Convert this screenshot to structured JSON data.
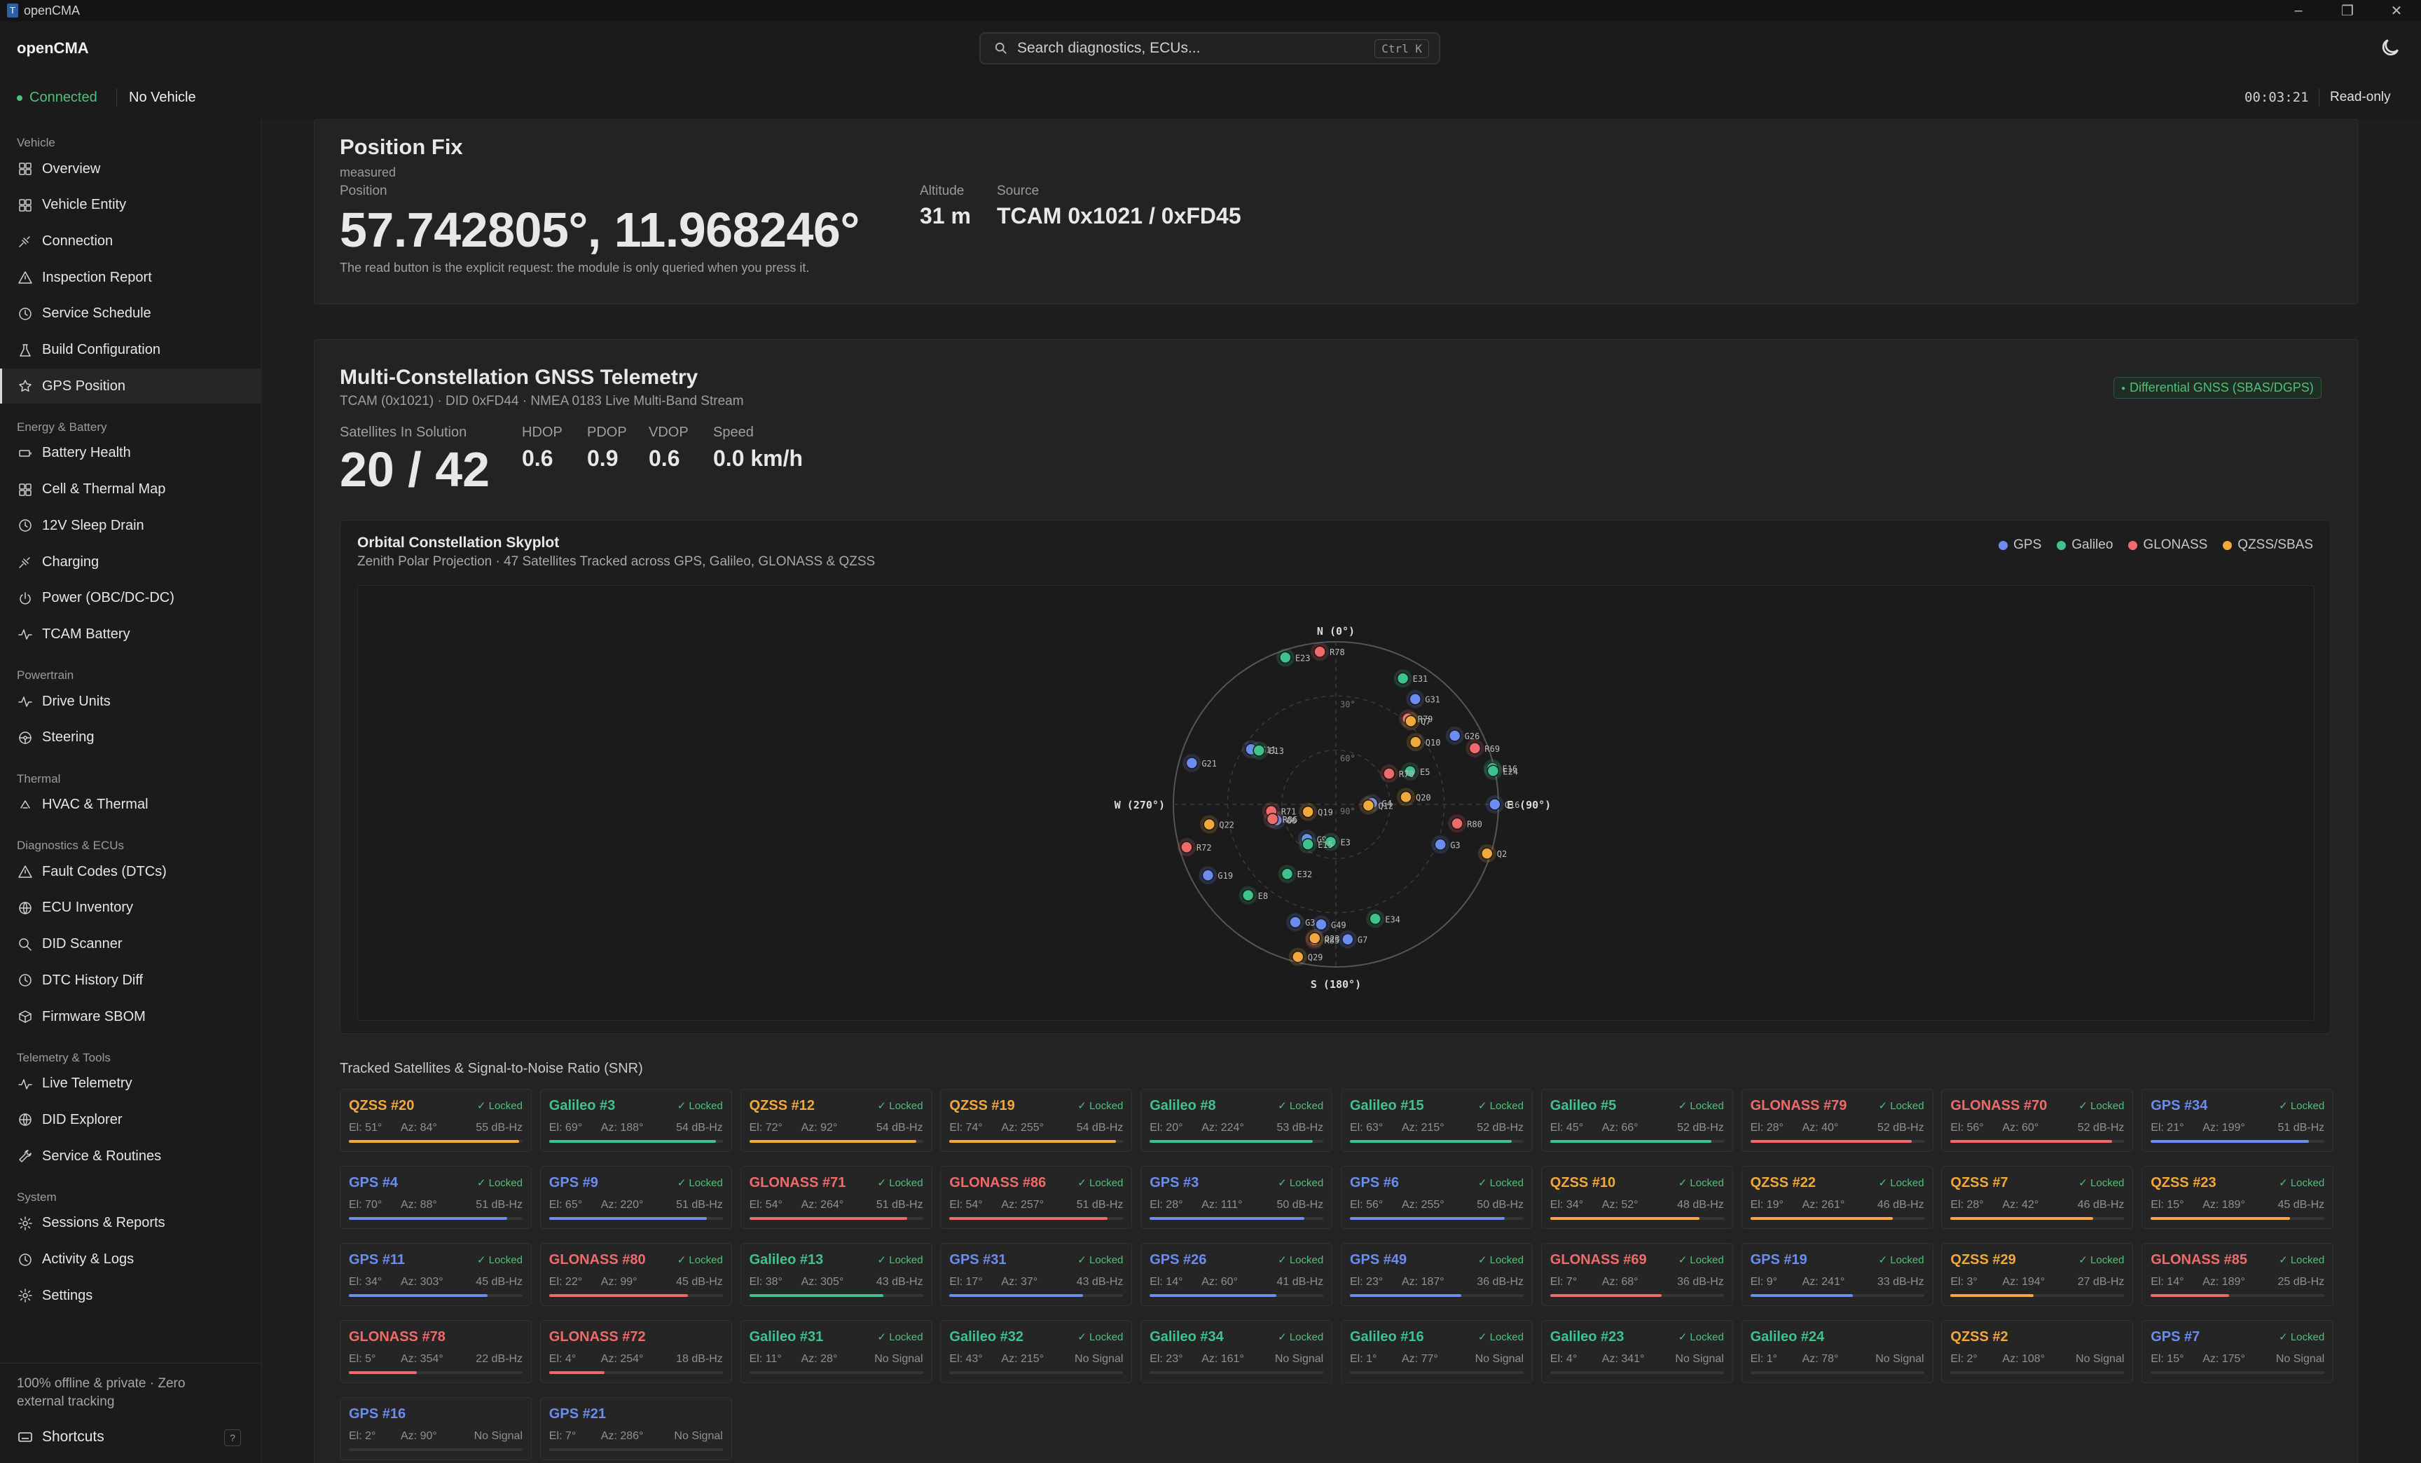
{
  "window": {
    "title": "openCMA"
  },
  "header": {
    "brand": "openCMA",
    "search_placeholder": "Search diagnostics, ECUs...",
    "search_shortcut": "Ctrl K"
  },
  "status": {
    "connection": "Connected",
    "vehicle": "No Vehicle",
    "clock": "00:03:21",
    "mode": "Read-only"
  },
  "colors": {
    "GPS": "#6b8cf0",
    "Galileo": "#3fc28b",
    "GLONASS": "#ef6b6b",
    "QZSS": "#f2a83b",
    "accent_green": "#4ec07a"
  },
  "sidebar": {
    "groups": [
      {
        "label": "Vehicle",
        "items": [
          {
            "label": "Overview",
            "icon": "grid-icon"
          },
          {
            "label": "Vehicle Entity",
            "icon": "grid-icon"
          },
          {
            "label": "Connection",
            "icon": "plug-icon"
          },
          {
            "label": "Inspection Report",
            "icon": "warning-icon"
          },
          {
            "label": "Service Schedule",
            "icon": "clock-icon"
          },
          {
            "label": "Build Configuration",
            "icon": "flask-icon"
          },
          {
            "label": "GPS Position",
            "icon": "star-icon",
            "active": true
          }
        ]
      },
      {
        "label": "Energy & Battery",
        "items": [
          {
            "label": "Battery Health",
            "icon": "battery-icon"
          },
          {
            "label": "Cell & Thermal Map",
            "icon": "grid-icon"
          },
          {
            "label": "12V Sleep Drain",
            "icon": "clock-icon"
          },
          {
            "label": "Charging",
            "icon": "plug-icon"
          },
          {
            "label": "Power (OBC/DC-DC)",
            "icon": "power-icon"
          },
          {
            "label": "TCAM Battery",
            "icon": "pulse-icon"
          }
        ]
      },
      {
        "label": "Powertrain",
        "items": [
          {
            "label": "Drive Units",
            "icon": "pulse-icon"
          },
          {
            "label": "Steering",
            "icon": "steering-icon"
          }
        ]
      },
      {
        "label": "Thermal",
        "items": [
          {
            "label": "HVAC & Thermal",
            "icon": "thermal-icon"
          }
        ]
      },
      {
        "label": "Diagnostics & ECUs",
        "items": [
          {
            "label": "Fault Codes (DTCs)",
            "icon": "warning-icon"
          },
          {
            "label": "ECU Inventory",
            "icon": "globe-icon"
          },
          {
            "label": "DID Scanner",
            "icon": "search-icon"
          },
          {
            "label": "DTC History Diff",
            "icon": "clock-icon"
          },
          {
            "label": "Firmware SBOM",
            "icon": "box-icon"
          }
        ]
      },
      {
        "label": "Telemetry & Tools",
        "items": [
          {
            "label": "Live Telemetry",
            "icon": "pulse-icon"
          },
          {
            "label": "DID Explorer",
            "icon": "globe-icon"
          },
          {
            "label": "Service & Routines",
            "icon": "wrench-icon"
          }
        ]
      },
      {
        "label": "System",
        "items": [
          {
            "label": "Sessions & Reports",
            "icon": "gear-icon"
          },
          {
            "label": "Activity & Logs",
            "icon": "clock-icon"
          },
          {
            "label": "Settings",
            "icon": "gear-icon"
          }
        ]
      }
    ],
    "footer": "100% offline & private · Zero external tracking",
    "shortcuts": "Shortcuts",
    "help": "?"
  },
  "position": {
    "title": "Position Fix",
    "measured": "measured",
    "label": "Position",
    "value": "57.742805°, 11.968246°",
    "altitude_label": "Altitude",
    "altitude": "31 m",
    "source_label": "Source",
    "source": "TCAM 0x1021 / 0xFD45",
    "note": "The read button is the explicit request: the module is only queried when you press it."
  },
  "gnss": {
    "title": "Multi-Constellation GNSS Telemetry",
    "subtitle": "TCAM (0x1021) · DID 0xFD44 · NMEA 0183 Live Multi-Band Stream",
    "badge": "Differential GNSS (SBAS/DGPS)",
    "sats_label": "Satellites In Solution",
    "sats": "20 / 42",
    "stats": [
      {
        "label": "HDOP",
        "value": "0.6"
      },
      {
        "label": "PDOP",
        "value": "0.9"
      },
      {
        "label": "VDOP",
        "value": "0.6"
      },
      {
        "label": "Speed",
        "value": "0.0 km/h"
      }
    ]
  },
  "skyplot": {
    "title": "Orbital Constellation Skyplot",
    "subtitle": "Zenith Polar Projection · 47 Satellites Tracked across GPS, Galileo, GLONASS & QZSS",
    "legend": [
      "GPS",
      "Galileo",
      "GLONASS",
      "QZSS/SBAS"
    ],
    "compass": {
      "N": "N (0°)",
      "E": "E (90°)",
      "S": "S (180°)",
      "W": "W (270°)"
    },
    "ring_labels": [
      "30°",
      "60°",
      "90°"
    ]
  },
  "chart_data": {
    "type": "scatter",
    "title": "Orbital Constellation Skyplot",
    "projection": "polar-zenith",
    "radial_axis": "elevation (90° center, 0° horizon)",
    "angular_axis": "azimuth (0° north, clockwise)",
    "series": [
      {
        "name": "GPS",
        "points": [
          {
            "label": "G34",
            "el": 21,
            "az": 199
          },
          {
            "label": "G4",
            "el": 70,
            "az": 88
          },
          {
            "label": "G9",
            "el": 65,
            "az": 220
          },
          {
            "label": "G3",
            "el": 28,
            "az": 111
          },
          {
            "label": "G6",
            "el": 56,
            "az": 255
          },
          {
            "label": "G11",
            "el": 34,
            "az": 303
          },
          {
            "label": "G31",
            "el": 17,
            "az": 37
          },
          {
            "label": "G26",
            "el": 14,
            "az": 60
          },
          {
            "label": "G49",
            "el": 23,
            "az": 187
          },
          {
            "label": "G19",
            "el": 9,
            "az": 241
          },
          {
            "label": "G7",
            "el": 15,
            "az": 175
          },
          {
            "label": "G16",
            "el": 2,
            "az": 90
          },
          {
            "label": "G21",
            "el": 7,
            "az": 286
          }
        ]
      },
      {
        "name": "Galileo",
        "points": [
          {
            "label": "E3",
            "el": 69,
            "az": 188
          },
          {
            "label": "E8",
            "el": 20,
            "az": 224
          },
          {
            "label": "E15",
            "el": 63,
            "az": 215
          },
          {
            "label": "E5",
            "el": 45,
            "az": 66
          },
          {
            "label": "E13",
            "el": 38,
            "az": 305
          },
          {
            "label": "E31",
            "el": 11,
            "az": 28
          },
          {
            "label": "E32",
            "el": 43,
            "az": 215
          },
          {
            "label": "E34",
            "el": 23,
            "az": 161
          },
          {
            "label": "E16",
            "el": 1,
            "az": 77
          },
          {
            "label": "E23",
            "el": 4,
            "az": 341
          },
          {
            "label": "E24",
            "el": 1,
            "az": 78
          }
        ]
      },
      {
        "name": "GLONASS",
        "points": [
          {
            "label": "R79",
            "el": 28,
            "az": 40
          },
          {
            "label": "R70",
            "el": 56,
            "az": 60
          },
          {
            "label": "R71",
            "el": 54,
            "az": 264
          },
          {
            "label": "R86",
            "el": 54,
            "az": 257
          },
          {
            "label": "R80",
            "el": 22,
            "az": 99
          },
          {
            "label": "R69",
            "el": 7,
            "az": 68
          },
          {
            "label": "R85",
            "el": 14,
            "az": 189
          },
          {
            "label": "R78",
            "el": 5,
            "az": 354
          },
          {
            "label": "R72",
            "el": 4,
            "az": 254
          }
        ]
      },
      {
        "name": "QZSS/SBAS",
        "points": [
          {
            "label": "Q20",
            "el": 51,
            "az": 84
          },
          {
            "label": "Q12",
            "el": 72,
            "az": 92
          },
          {
            "label": "Q19",
            "el": 74,
            "az": 255
          },
          {
            "label": "Q10",
            "el": 34,
            "az": 52
          },
          {
            "label": "Q22",
            "el": 19,
            "az": 261
          },
          {
            "label": "Q7",
            "el": 28,
            "az": 42
          },
          {
            "label": "Q23",
            "el": 15,
            "az": 189
          },
          {
            "label": "Q29",
            "el": 3,
            "az": 194
          },
          {
            "label": "Q2",
            "el": 2,
            "az": 108
          }
        ]
      }
    ]
  },
  "snr": {
    "title": "Tracked Satellites & Signal-to-Noise Ratio (SNR)",
    "locked_label": "✓ Locked",
    "tiles": [
      {
        "name": "QZSS #20",
        "sys": "QZSS",
        "el": "El: 51°",
        "az": "Az: 84°",
        "snr": "55 dB-Hz",
        "locked": true,
        "level": 0.98
      },
      {
        "name": "Galileo #3",
        "sys": "Galileo",
        "el": "El: 69°",
        "az": "Az: 188°",
        "snr": "54 dB-Hz",
        "locked": true,
        "level": 0.96
      },
      {
        "name": "QZSS #12",
        "sys": "QZSS",
        "el": "El: 72°",
        "az": "Az: 92°",
        "snr": "54 dB-Hz",
        "locked": true,
        "level": 0.96
      },
      {
        "name": "QZSS #19",
        "sys": "QZSS",
        "el": "El: 74°",
        "az": "Az: 255°",
        "snr": "54 dB-Hz",
        "locked": true,
        "level": 0.96
      },
      {
        "name": "Galileo #8",
        "sys": "Galileo",
        "el": "El: 20°",
        "az": "Az: 224°",
        "snr": "53 dB-Hz",
        "locked": true,
        "level": 0.94
      },
      {
        "name": "Galileo #15",
        "sys": "Galileo",
        "el": "El: 63°",
        "az": "Az: 215°",
        "snr": "52 dB-Hz",
        "locked": true,
        "level": 0.93
      },
      {
        "name": "Galileo #5",
        "sys": "Galileo",
        "el": "El: 45°",
        "az": "Az: 66°",
        "snr": "52 dB-Hz",
        "locked": true,
        "level": 0.93
      },
      {
        "name": "GLONASS #79",
        "sys": "GLONASS",
        "el": "El: 28°",
        "az": "Az: 40°",
        "snr": "52 dB-Hz",
        "locked": true,
        "level": 0.93
      },
      {
        "name": "GLONASS #70",
        "sys": "GLONASS",
        "el": "El: 56°",
        "az": "Az: 60°",
        "snr": "52 dB-Hz",
        "locked": true,
        "level": 0.93
      },
      {
        "name": "GPS #34",
        "sys": "GPS",
        "el": "El: 21°",
        "az": "Az: 199°",
        "snr": "51 dB-Hz",
        "locked": true,
        "level": 0.91
      },
      {
        "name": "GPS #4",
        "sys": "GPS",
        "el": "El: 70°",
        "az": "Az: 88°",
        "snr": "51 dB-Hz",
        "locked": true,
        "level": 0.91
      },
      {
        "name": "GPS #9",
        "sys": "GPS",
        "el": "El: 65°",
        "az": "Az: 220°",
        "snr": "51 dB-Hz",
        "locked": true,
        "level": 0.91
      },
      {
        "name": "GLONASS #71",
        "sys": "GLONASS",
        "el": "El: 54°",
        "az": "Az: 264°",
        "snr": "51 dB-Hz",
        "locked": true,
        "level": 0.91
      },
      {
        "name": "GLONASS #86",
        "sys": "GLONASS",
        "el": "El: 54°",
        "az": "Az: 257°",
        "snr": "51 dB-Hz",
        "locked": true,
        "level": 0.91
      },
      {
        "name": "GPS #3",
        "sys": "GPS",
        "el": "El: 28°",
        "az": "Az: 111°",
        "snr": "50 dB-Hz",
        "locked": true,
        "level": 0.89
      },
      {
        "name": "GPS #6",
        "sys": "GPS",
        "el": "El: 56°",
        "az": "Az: 255°",
        "snr": "50 dB-Hz",
        "locked": true,
        "level": 0.89
      },
      {
        "name": "QZSS #10",
        "sys": "QZSS",
        "el": "El: 34°",
        "az": "Az: 52°",
        "snr": "48 dB-Hz",
        "locked": true,
        "level": 0.86
      },
      {
        "name": "QZSS #22",
        "sys": "QZSS",
        "el": "El: 19°",
        "az": "Az: 261°",
        "snr": "46 dB-Hz",
        "locked": true,
        "level": 0.82
      },
      {
        "name": "QZSS #7",
        "sys": "QZSS",
        "el": "El: 28°",
        "az": "Az: 42°",
        "snr": "46 dB-Hz",
        "locked": true,
        "level": 0.82
      },
      {
        "name": "QZSS #23",
        "sys": "QZSS",
        "el": "El: 15°",
        "az": "Az: 189°",
        "snr": "45 dB-Hz",
        "locked": true,
        "level": 0.8
      },
      {
        "name": "GPS #11",
        "sys": "GPS",
        "el": "El: 34°",
        "az": "Az: 303°",
        "snr": "45 dB-Hz",
        "locked": true,
        "level": 0.8
      },
      {
        "name": "GLONASS #80",
        "sys": "GLONASS",
        "el": "El: 22°",
        "az": "Az: 99°",
        "snr": "45 dB-Hz",
        "locked": true,
        "level": 0.8
      },
      {
        "name": "Galileo #13",
        "sys": "Galileo",
        "el": "El: 38°",
        "az": "Az: 305°",
        "snr": "43 dB-Hz",
        "locked": true,
        "level": 0.77
      },
      {
        "name": "GPS #31",
        "sys": "GPS",
        "el": "El: 17°",
        "az": "Az: 37°",
        "snr": "43 dB-Hz",
        "locked": true,
        "level": 0.77
      },
      {
        "name": "GPS #26",
        "sys": "GPS",
        "el": "El: 14°",
        "az": "Az: 60°",
        "snr": "41 dB-Hz",
        "locked": true,
        "level": 0.73
      },
      {
        "name": "GPS #49",
        "sys": "GPS",
        "el": "El: 23°",
        "az": "Az: 187°",
        "snr": "36 dB-Hz",
        "locked": true,
        "level": 0.64
      },
      {
        "name": "GLONASS #69",
        "sys": "GLONASS",
        "el": "El: 7°",
        "az": "Az: 68°",
        "snr": "36 dB-Hz",
        "locked": true,
        "level": 0.64
      },
      {
        "name": "GPS #19",
        "sys": "GPS",
        "el": "El: 9°",
        "az": "Az: 241°",
        "snr": "33 dB-Hz",
        "locked": true,
        "level": 0.59
      },
      {
        "name": "QZSS #29",
        "sys": "QZSS",
        "el": "El: 3°",
        "az": "Az: 194°",
        "snr": "27 dB-Hz",
        "locked": true,
        "level": 0.48
      },
      {
        "name": "GLONASS #85",
        "sys": "GLONASS",
        "el": "El: 14°",
        "az": "Az: 189°",
        "snr": "25 dB-Hz",
        "locked": true,
        "level": 0.45
      },
      {
        "name": "GLONASS #78",
        "sys": "GLONASS",
        "el": "El: 5°",
        "az": "Az: 354°",
        "snr": "22 dB-Hz",
        "locked": false,
        "level": 0.39
      },
      {
        "name": "GLONASS #72",
        "sys": "GLONASS",
        "el": "El: 4°",
        "az": "Az: 254°",
        "snr": "18 dB-Hz",
        "locked": false,
        "level": 0.32
      },
      {
        "name": "Galileo #31",
        "sys": "Galileo",
        "el": "El: 11°",
        "az": "Az: 28°",
        "snr": "No Signal",
        "locked": true,
        "level": 0
      },
      {
        "name": "Galileo #32",
        "sys": "Galileo",
        "el": "El: 43°",
        "az": "Az: 215°",
        "snr": "No Signal",
        "locked": true,
        "level": 0
      },
      {
        "name": "Galileo #34",
        "sys": "Galileo",
        "el": "El: 23°",
        "az": "Az: 161°",
        "snr": "No Signal",
        "locked": true,
        "level": 0
      },
      {
        "name": "Galileo #16",
        "sys": "Galileo",
        "el": "El: 1°",
        "az": "Az: 77°",
        "snr": "No Signal",
        "locked": true,
        "level": 0
      },
      {
        "name": "Galileo #23",
        "sys": "Galileo",
        "el": "El: 4°",
        "az": "Az: 341°",
        "snr": "No Signal",
        "locked": true,
        "level": 0
      },
      {
        "name": "Galileo #24",
        "sys": "Galileo",
        "el": "El: 1°",
        "az": "Az: 78°",
        "snr": "No Signal",
        "locked": false,
        "level": 0
      },
      {
        "name": "QZSS #2",
        "sys": "QZSS",
        "el": "El: 2°",
        "az": "Az: 108°",
        "snr": "No Signal",
        "locked": false,
        "level": 0
      },
      {
        "name": "GPS #7",
        "sys": "GPS",
        "el": "El: 15°",
        "az": "Az: 175°",
        "snr": "No Signal",
        "locked": true,
        "level": 0
      },
      {
        "name": "GPS #16",
        "sys": "GPS",
        "el": "El: 2°",
        "az": "Az: 90°",
        "snr": "No Signal",
        "locked": false,
        "level": 0
      },
      {
        "name": "GPS #21",
        "sys": "GPS",
        "el": "El: 7°",
        "az": "Az: 286°",
        "snr": "No Signal",
        "locked": false,
        "level": 0
      }
    ]
  }
}
